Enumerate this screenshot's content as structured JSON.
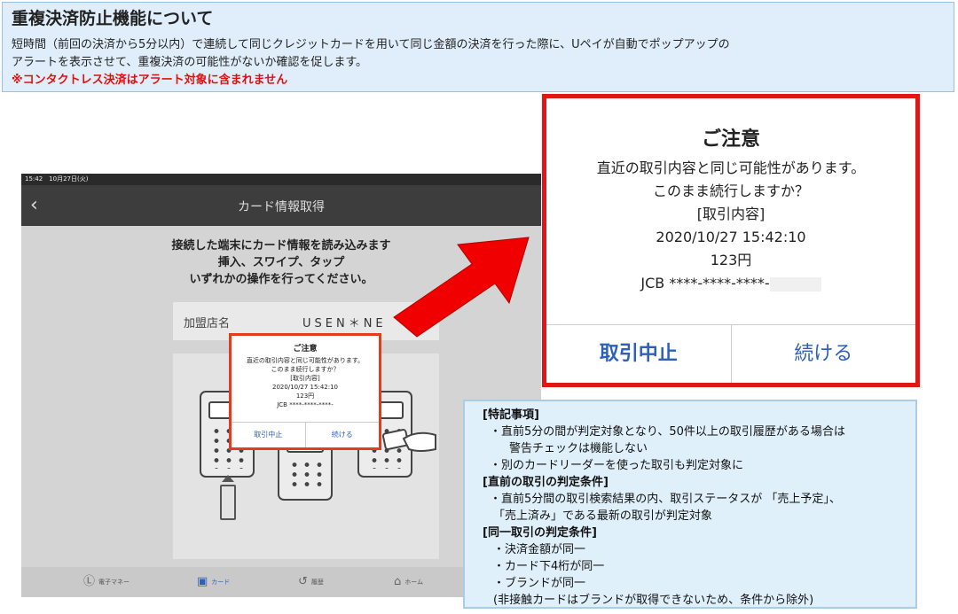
{
  "header": {
    "title": "重複決済防止機能について",
    "desc_line1": "短時間（前回の決済から5分以内）で連続して同じクレジットカードを用いて同じ金額の決済を行った際に、Uペイが自動でポップアップの",
    "desc_line2": "アラートを表示させて、重複決済の可能性がないか確認を促します。",
    "warning": "※コンタクトレス決済はアラート対象に含まれません",
    "colors": {
      "background": "#dfeefa",
      "warning": "#e01010"
    }
  },
  "tablet": {
    "status_time": "15:42　10月27日(火)",
    "back_icon": "chevron-left-icon",
    "title": "カード情報取得",
    "instruction": [
      "接続した端末にカード情報を読み込みます",
      "挿入、スワイプ、タップ",
      "いずれかの操作を行ってください。"
    ],
    "merchant_label": "加盟店名",
    "merchant_value": "USEN＊NE",
    "nav": [
      {
        "label": "電子マネー",
        "icon": "ic-card-icon"
      },
      {
        "label": "カード",
        "icon": "card-icon",
        "active": true
      },
      {
        "label": "履歴",
        "icon": "history-icon"
      },
      {
        "label": "ホーム",
        "icon": "home-icon"
      }
    ]
  },
  "dialog": {
    "title": "ご注意",
    "line1": "直近の取引内容と同じ可能性があります。",
    "line2": "このまま続行しますか？",
    "line3": "[取引内容]",
    "datetime": "2020/10/27 15:42:10",
    "amount": "123円",
    "card": "JCB ****-****-****-",
    "cancel": "取引中止",
    "continue": "続ける",
    "colors": {
      "border": "#e01717",
      "button": "#2d5fbd"
    }
  },
  "notes": {
    "h1": "[特記事項]",
    "n1a": "・直前5分の間が判定対象となり、50件以上の取引履歴がある場合は",
    "n1b": "警告チェックは機能しない",
    "n2": "・別のカードリーダーを使った取引も判定対象に",
    "h2": "[直前の取引の判定条件]",
    "n3a": "・直前5分間の取引検索結果の内、取引ステータスが 「売上予定」、",
    "n3b": "「売上済み」である最新の取引が判定対象",
    "h3": "[同一取引の判定条件]",
    "n4": "・決済金額が同一",
    "n5": "・カード下4桁が同一",
    "n6": "・ブランドが同一",
    "n7": "(非接触カードはブランドが取得できないため、条件から除外)",
    "colors": {
      "background": "#dff0fa"
    }
  }
}
